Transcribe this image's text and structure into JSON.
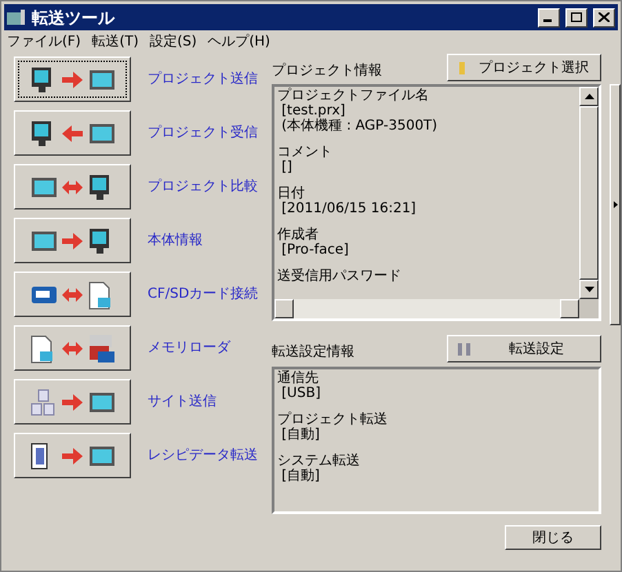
{
  "window": {
    "title": "転送ツール"
  },
  "menu": [
    "ファイル(F)",
    "転送(T)",
    "設定(S)",
    "ヘルプ(H)"
  ],
  "actions": [
    {
      "label": "プロジェクト送信",
      "focused": true
    },
    {
      "label": "プロジェクト受信",
      "focused": false
    },
    {
      "label": "プロジェクト比較",
      "focused": false
    },
    {
      "label": "本体情報",
      "focused": false
    },
    {
      "label": "CF/SDカード接続",
      "focused": false
    },
    {
      "label": "メモリローダ",
      "focused": false
    },
    {
      "label": "サイト送信",
      "focused": false
    },
    {
      "label": "レシピデータ転送",
      "focused": false
    }
  ],
  "project_info": {
    "title": "プロジェクト情報",
    "button": "プロジェクト選択",
    "groups": [
      {
        "label": "プロジェクトファイル名",
        "values": [
          "[test.prx]",
          "(本体機種 : AGP-3500T)"
        ]
      },
      {
        "label": "コメント",
        "values": [
          "[]"
        ]
      },
      {
        "label": "日付",
        "values": [
          "[2011/06/15 16:21]"
        ]
      },
      {
        "label": "作成者",
        "values": [
          "[Pro-face]"
        ]
      },
      {
        "label": "送受信用パスワード"
      }
    ]
  },
  "transfer_info": {
    "title": "転送設定情報",
    "button": "転送設定",
    "groups": [
      {
        "label": "通信先",
        "values": [
          "[USB]"
        ]
      },
      {
        "label": "プロジェクト転送",
        "values": [
          "[自動]"
        ]
      },
      {
        "label": "システム転送",
        "values": [
          "[自動]"
        ]
      }
    ]
  },
  "close_button": "閉じる"
}
